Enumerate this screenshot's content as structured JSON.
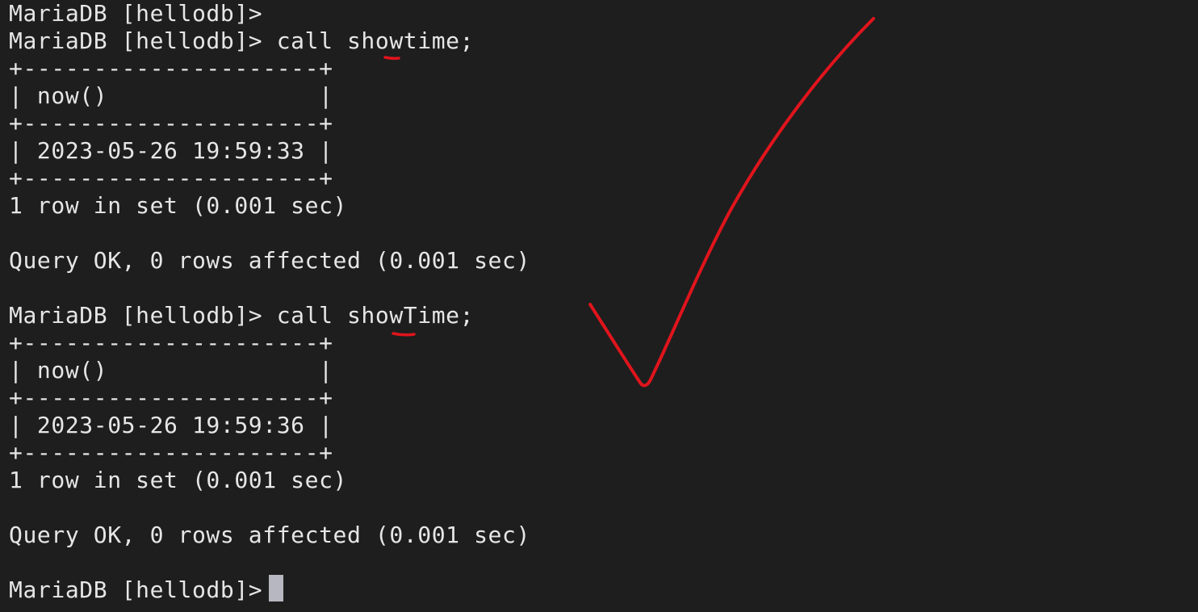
{
  "terminal": {
    "lines": [
      "MariaDB [hellodb]>",
      "MariaDB [hellodb]> call showtime;",
      "+---------------------+",
      "| now()               |",
      "+---------------------+",
      "| 2023-05-26 19:59:33 |",
      "+---------------------+",
      "1 row in set (0.001 sec)",
      "",
      "Query OK, 0 rows affected (0.001 sec)",
      "",
      "MariaDB [hellodb]> call showTime;",
      "+---------------------+",
      "| now()               |",
      "+---------------------+",
      "| 2023-05-26 19:59:36 |",
      "+---------------------+",
      "1 row in set (0.001 sec)",
      "",
      "Query OK, 0 rows affected (0.001 sec)",
      "",
      "MariaDB [hellodb]> "
    ]
  },
  "annotation": {
    "color": "#e0141c"
  }
}
